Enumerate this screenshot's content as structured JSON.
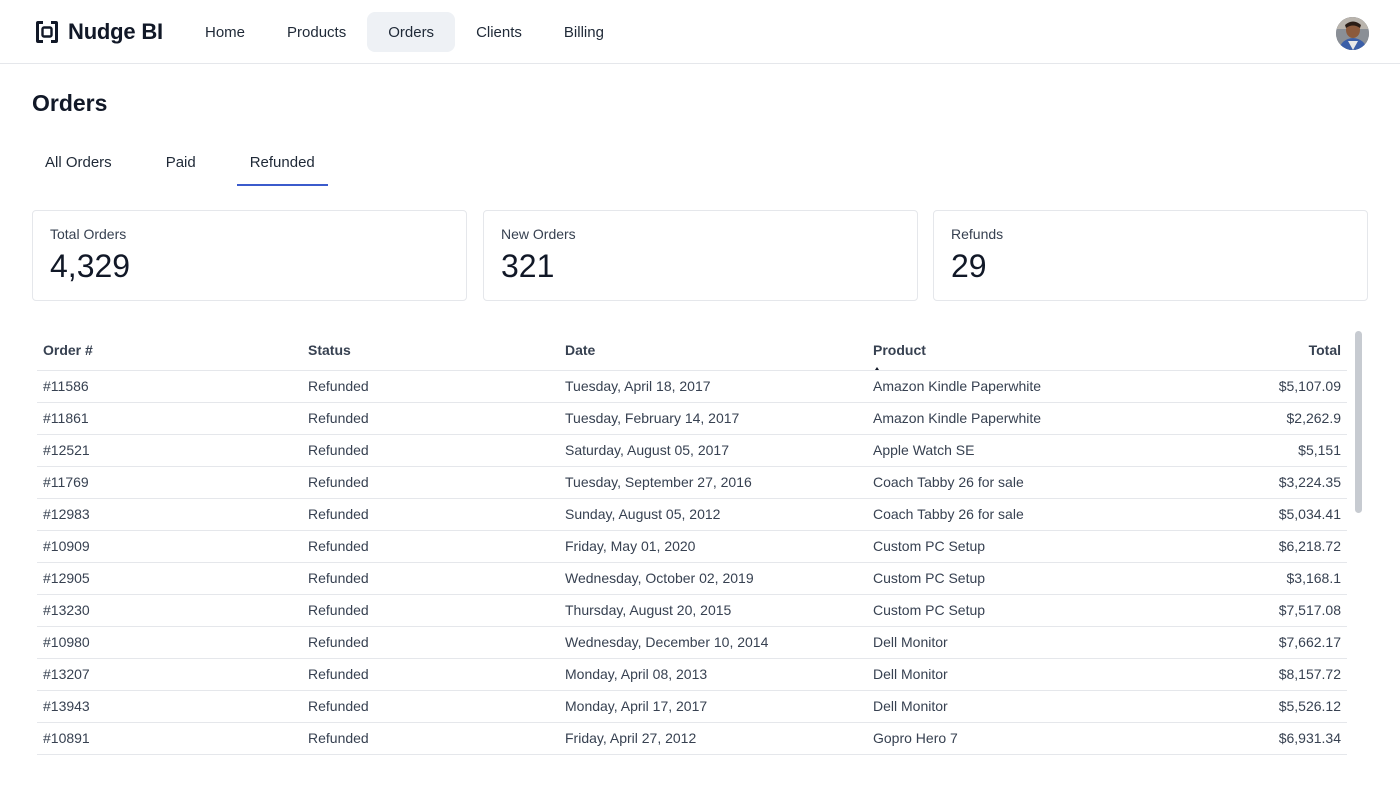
{
  "app": {
    "name": "Nudge BI"
  },
  "nav": {
    "items": [
      {
        "label": "Home",
        "active": false
      },
      {
        "label": "Products",
        "active": false
      },
      {
        "label": "Orders",
        "active": true
      },
      {
        "label": "Clients",
        "active": false
      },
      {
        "label": "Billing",
        "active": false
      }
    ]
  },
  "page": {
    "title": "Orders"
  },
  "tabs": [
    {
      "label": "All Orders",
      "active": false
    },
    {
      "label": "Paid",
      "active": false
    },
    {
      "label": "Refunded",
      "active": true
    }
  ],
  "stats": [
    {
      "label": "Total Orders",
      "value": "4,329"
    },
    {
      "label": "New Orders",
      "value": "321"
    },
    {
      "label": "Refunds",
      "value": "29"
    }
  ],
  "table": {
    "columns": [
      "Order #",
      "Status",
      "Date",
      "Product",
      "Total"
    ],
    "sorted_column": "Product",
    "sort_direction": "ascending",
    "rows": [
      [
        "#11586",
        "Refunded",
        "Tuesday, April 18, 2017",
        "Amazon Kindle Paperwhite",
        "$5,107.09"
      ],
      [
        "#11861",
        "Refunded",
        "Tuesday, February 14, 2017",
        "Amazon Kindle Paperwhite",
        "$2,262.9"
      ],
      [
        "#12521",
        "Refunded",
        "Saturday, August 05, 2017",
        "Apple Watch SE",
        "$5,151"
      ],
      [
        "#11769",
        "Refunded",
        "Tuesday, September 27, 2016",
        "Coach Tabby 26 for sale",
        "$3,224.35"
      ],
      [
        "#12983",
        "Refunded",
        "Sunday, August 05, 2012",
        "Coach Tabby 26 for sale",
        "$5,034.41"
      ],
      [
        "#10909",
        "Refunded",
        "Friday, May 01, 2020",
        "Custom PC Setup",
        "$6,218.72"
      ],
      [
        "#12905",
        "Refunded",
        "Wednesday, October 02, 2019",
        "Custom PC Setup",
        "$3,168.1"
      ],
      [
        "#13230",
        "Refunded",
        "Thursday, August 20, 2015",
        "Custom PC Setup",
        "$7,517.08"
      ],
      [
        "#10980",
        "Refunded",
        "Wednesday, December 10, 2014",
        "Dell Monitor",
        "$7,662.17"
      ],
      [
        "#13207",
        "Refunded",
        "Monday, April 08, 2013",
        "Dell Monitor",
        "$8,157.72"
      ],
      [
        "#13943",
        "Refunded",
        "Monday, April 17, 2017",
        "Dell Monitor",
        "$5,526.12"
      ],
      [
        "#10891",
        "Refunded",
        "Friday, April 27, 2012",
        "Gopro Hero 7",
        "$6,931.34"
      ]
    ]
  },
  "colors": {
    "accent": "#3b5bcc",
    "nav_active_bg": "#eef1f5",
    "border": "#e5e7eb",
    "text": "#1f2937"
  },
  "icons": {
    "brand": "brand-logo-icon",
    "sort": "sort-ascending-icon",
    "avatar": "user-avatar"
  }
}
